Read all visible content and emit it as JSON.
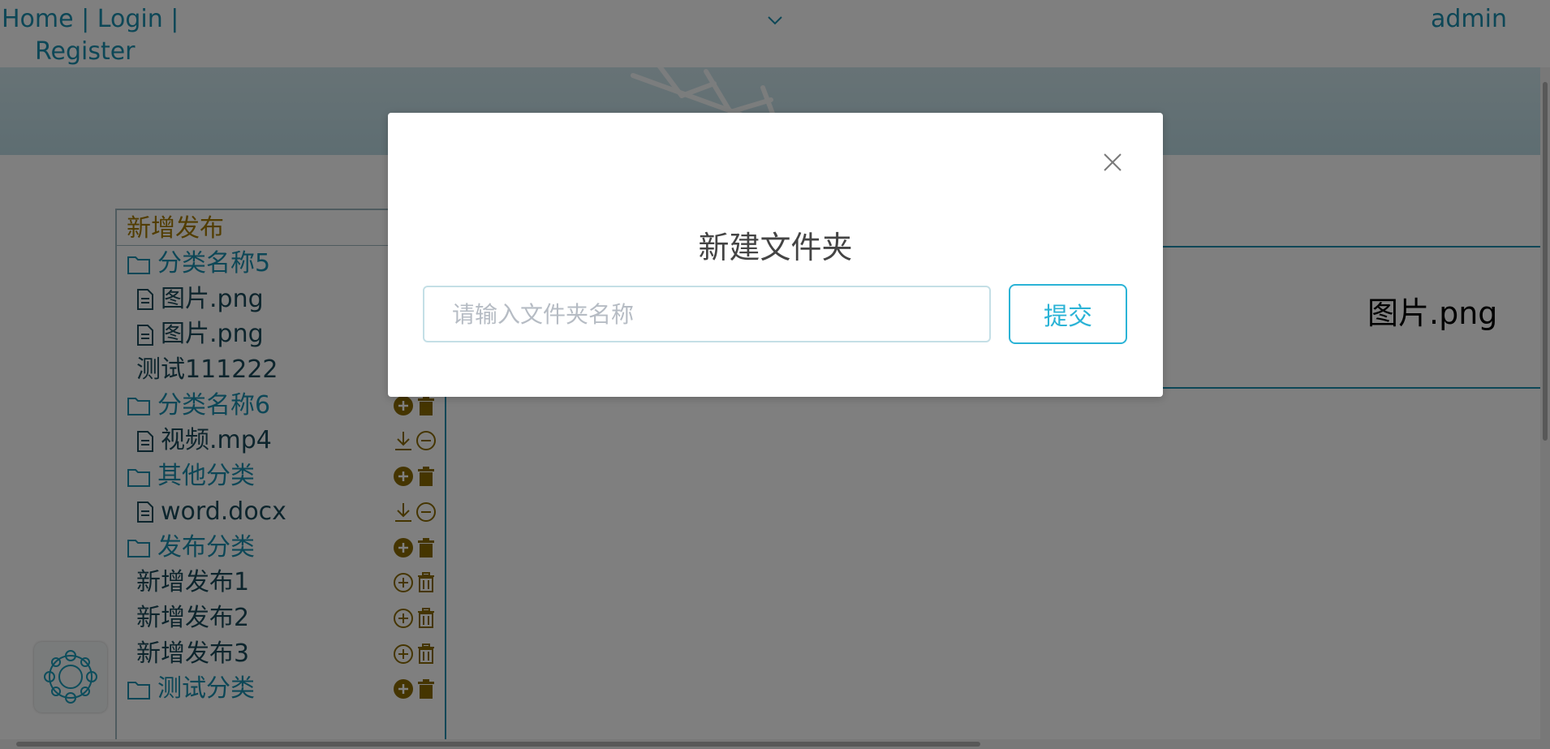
{
  "nav": {
    "home": "Home",
    "sep": "|",
    "login": "Login",
    "register": "Register",
    "user": "admin"
  },
  "sidebar": {
    "title": "新增发布",
    "items": [
      {
        "type": "folder",
        "label": "分类名称5"
      },
      {
        "type": "file",
        "label": "图片.png"
      },
      {
        "type": "file",
        "label": "图片.png"
      },
      {
        "type": "file",
        "label": "测试111222"
      },
      {
        "type": "folder",
        "label": "分类名称6"
      },
      {
        "type": "file",
        "label": "视频.mp4"
      },
      {
        "type": "folder",
        "label": "其他分类"
      },
      {
        "type": "file",
        "label": "word.docx"
      },
      {
        "type": "folder",
        "label": "发布分类"
      },
      {
        "type": "file",
        "label": "新增发布1"
      },
      {
        "type": "file",
        "label": "新增发布2"
      },
      {
        "type": "file",
        "label": "新增发布3"
      },
      {
        "type": "folder",
        "label": "测试分类"
      }
    ]
  },
  "content": {
    "file_name": "图片.png"
  },
  "modal": {
    "title": "新建文件夹",
    "input_placeholder": "请输入文件夹名称",
    "input_value": "",
    "submit_label": "提交"
  },
  "colors": {
    "accent": "#1a8fae",
    "gold": "#a57b00",
    "submit": "#2bb3d6"
  }
}
